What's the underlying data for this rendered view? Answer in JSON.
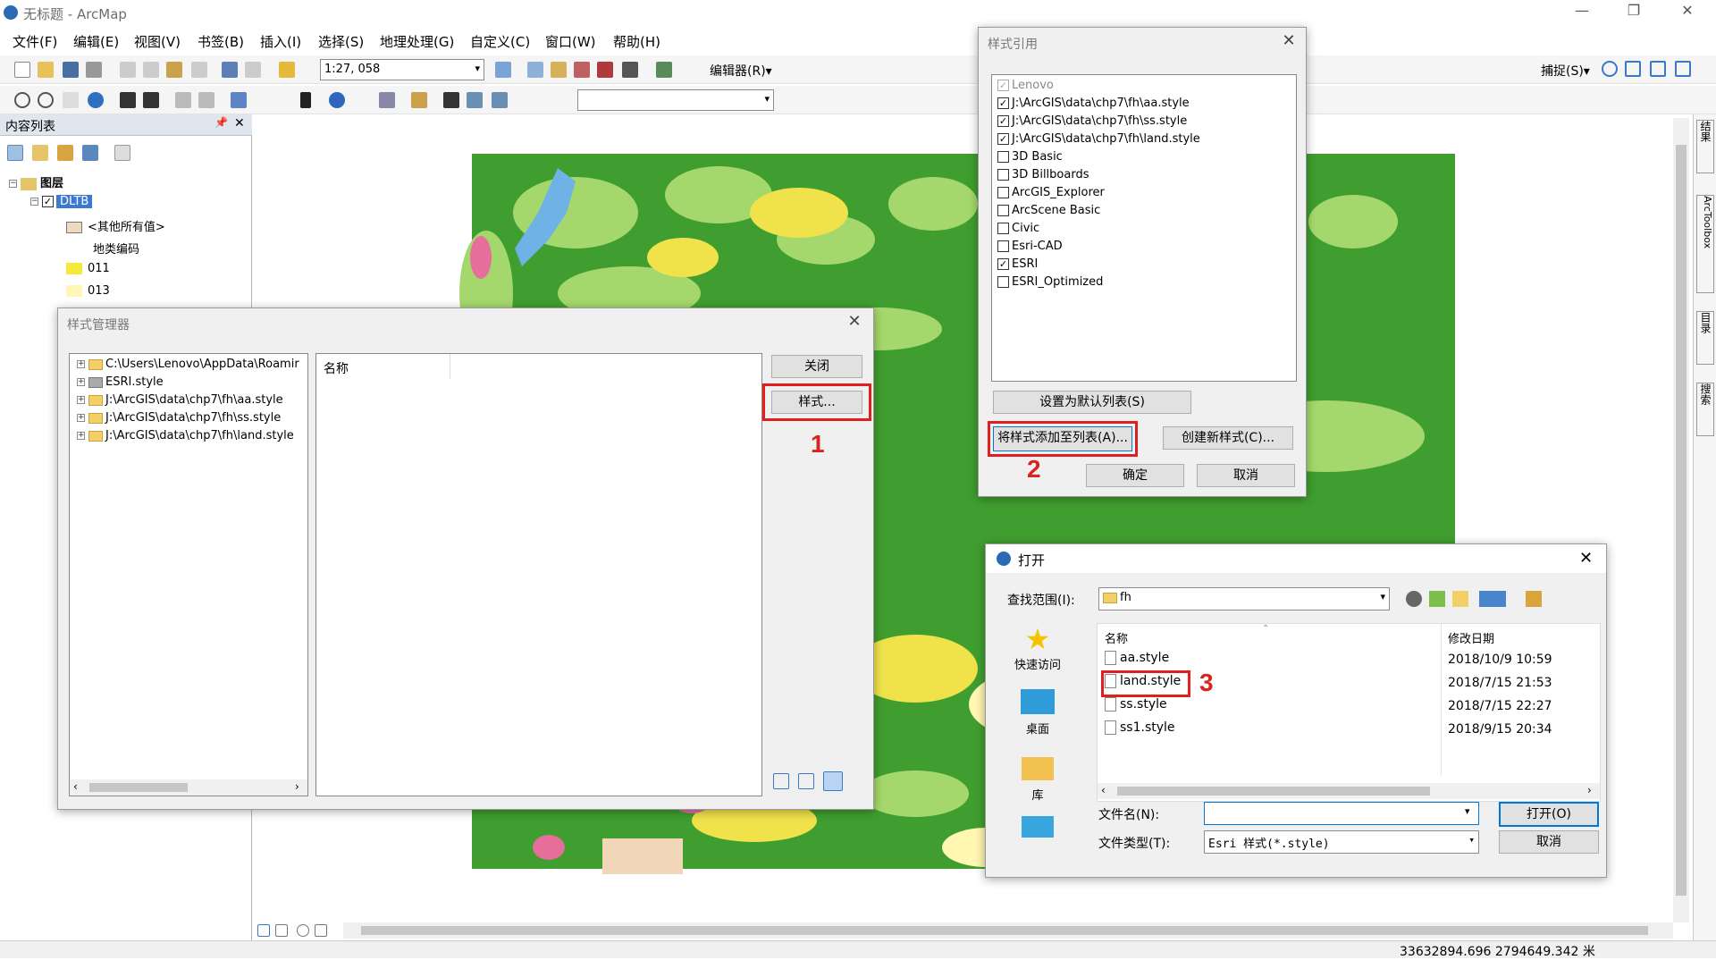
{
  "window": {
    "title": "无标题 - ArcMap",
    "minimize": "—",
    "restore": "❐",
    "close": "✕"
  },
  "menu": [
    "文件(F)",
    "编辑(E)",
    "视图(V)",
    "书签(B)",
    "插入(I)",
    "选择(S)",
    "地理处理(G)",
    "自定义(C)",
    "窗口(W)",
    "帮助(H)"
  ],
  "toolbar": {
    "scale": "1:27, 058",
    "editor": "编辑器(R)▾",
    "snap": "捕捉(S)▾"
  },
  "toc": {
    "title": "内容列表",
    "pin": "📌",
    "close": "✕",
    "layers_label": "图层",
    "layer_name": "DLTB",
    "other_values": "<其他所有值>",
    "field_name": "地类编码",
    "classes": [
      {
        "label": "011",
        "color": "#f5ea3c"
      },
      {
        "label": "013",
        "color": "#fff6b8"
      }
    ]
  },
  "style_manager": {
    "title": "样式管理器",
    "close_x": "✕",
    "tree": [
      "C:\\Users\\Lenovo\\AppData\\Roamir",
      "ESRI.style",
      "J:\\ArcGIS\\data\\chp7\\fh\\aa.style",
      "J:\\ArcGIS\\data\\chp7\\fh\\ss.style",
      "J:\\ArcGIS\\data\\chp7\\fh\\land.style"
    ],
    "column_header": "名称",
    "close_button": "关闭",
    "styles_button": "样式...",
    "step": "1"
  },
  "style_refs": {
    "title": "样式引用",
    "close_x": "✕",
    "items": [
      {
        "label": "Lenovo",
        "checked": true,
        "disabled": true
      },
      {
        "label": "J:\\ArcGIS\\data\\chp7\\fh\\aa.style",
        "checked": true
      },
      {
        "label": "J:\\ArcGIS\\data\\chp7\\fh\\ss.style",
        "checked": true
      },
      {
        "label": "J:\\ArcGIS\\data\\chp7\\fh\\land.style",
        "checked": true
      },
      {
        "label": "3D Basic",
        "checked": false
      },
      {
        "label": "3D Billboards",
        "checked": false
      },
      {
        "label": "ArcGIS_Explorer",
        "checked": false
      },
      {
        "label": "ArcScene Basic",
        "checked": false
      },
      {
        "label": "Civic",
        "checked": false
      },
      {
        "label": "Esri-CAD",
        "checked": false
      },
      {
        "label": "ESRI",
        "checked": true
      },
      {
        "label": "ESRI_Optimized",
        "checked": false
      }
    ],
    "set_default": "设置为默认列表(S)",
    "add_to_list": "将样式添加至列表(A)...",
    "create_new": "创建新样式(C)...",
    "ok": "确定",
    "cancel": "取消",
    "step": "2"
  },
  "open_dialog": {
    "title": "打开",
    "close_x": "✕",
    "look_in_label": "查找范围(I):",
    "look_in_value": "fh",
    "places": [
      "快速访问",
      "桌面",
      "库"
    ],
    "col_name": "名称",
    "col_date": "修改日期",
    "files": [
      {
        "name": "aa.style",
        "date": "2018/10/9 10:59"
      },
      {
        "name": "land.style",
        "date": "2018/7/15 21:53"
      },
      {
        "name": "ss.style",
        "date": "2018/7/15 22:27"
      },
      {
        "name": "ss1.style",
        "date": "2018/9/15 20:34"
      }
    ],
    "filename_label": "文件名(N):",
    "filename_value": "",
    "filetype_label": "文件类型(T):",
    "filetype_value": "Esri 样式(*.style)",
    "open_button": "打开(O)",
    "cancel_button": "取消",
    "step": "3"
  },
  "right_dock": [
    "结果",
    "ArcToolbox",
    "目录",
    "搜索"
  ],
  "status": {
    "coords": "33632894.696  2794649.342 米"
  },
  "colors": {
    "red_highlight": "#e0201e",
    "map_green": "#3f9e2f",
    "map_light_green": "#a5d86c",
    "map_yellow": "#f0e24a",
    "map_pink": "#e66e9a"
  }
}
